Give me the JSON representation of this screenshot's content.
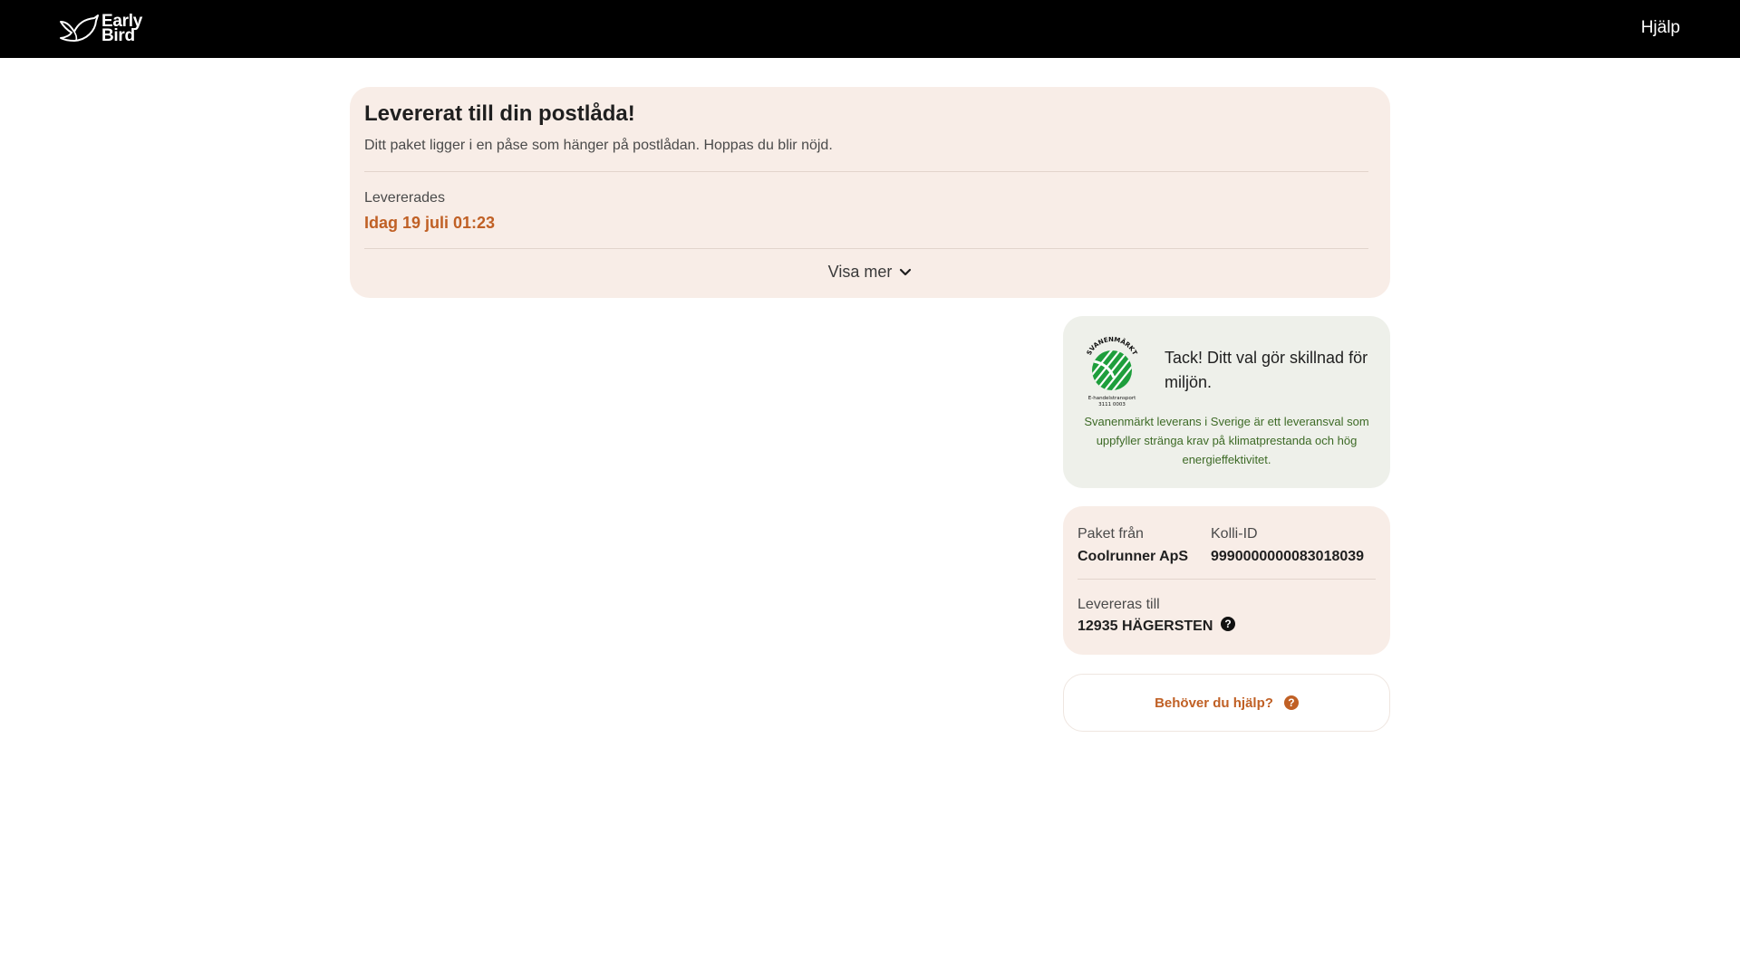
{
  "header": {
    "logo_line1": "Early",
    "logo_line2": "Bird",
    "help_label": "Hjälp",
    "background": "#000000"
  },
  "status": {
    "title": "Levererat till din postlåda!",
    "subtitle": "Ditt paket ligger i en påse som hänger på postlådan. Hoppas du blir nöjd.",
    "delivered_label": "Levererades",
    "delivered_value": "Idag 19 juli 01:23",
    "show_more_label": "Visa mer",
    "accent_color": "#c06025",
    "background": "#f8ede7"
  },
  "eco": {
    "logo_top_text": "SVANENMÄRKT",
    "logo_bottom_text": "E-handelstransport",
    "logo_number": "3111 0003",
    "title": "Tack! Ditt val gör skillnad för miljön.",
    "description": "Svanenmärkt leverans i Sverige är ett leveransval som uppfyller stränga krav på klimatprestanda och hög energieffektivitet.",
    "text_color": "#3d6a26",
    "logo_color": "#1e9e3c"
  },
  "parcel": {
    "from_label": "Paket från",
    "from_value": "Coolrunner ApS",
    "id_label": "Kolli-ID",
    "id_value": "9990000000083018039",
    "to_label": "Levereras till",
    "to_value": "12935 HÄGERSTEN",
    "info_icon": "?"
  },
  "help_card": {
    "label": "Behöver du hjälp?",
    "icon": "?"
  }
}
